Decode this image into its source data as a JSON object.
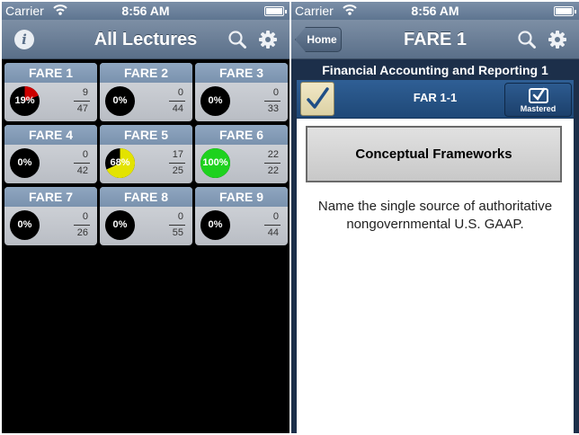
{
  "status": {
    "carrier": "Carrier",
    "time": "8:56 AM"
  },
  "left": {
    "title": "All Lectures",
    "tiles": [
      {
        "name": "FARE 1",
        "percent": "19%",
        "fraction": 0.19,
        "num": "9",
        "den": "47",
        "fill": "#cc0000"
      },
      {
        "name": "FARE 2",
        "percent": "0%",
        "fraction": 0,
        "num": "0",
        "den": "44",
        "fill": "#000000"
      },
      {
        "name": "FARE 3",
        "percent": "0%",
        "fraction": 0,
        "num": "0",
        "den": "33",
        "fill": "#000000"
      },
      {
        "name": "FARE 4",
        "percent": "0%",
        "fraction": 0,
        "num": "0",
        "den": "42",
        "fill": "#000000"
      },
      {
        "name": "FARE 5",
        "percent": "68%",
        "fraction": 0.68,
        "num": "17",
        "den": "25",
        "fill": "#e3e300"
      },
      {
        "name": "FARE 6",
        "percent": "100%",
        "fraction": 1,
        "num": "22",
        "den": "22",
        "fill": "#1ed21e"
      },
      {
        "name": "FARE 7",
        "percent": "0%",
        "fraction": 0,
        "num": "0",
        "den": "26",
        "fill": "#000000"
      },
      {
        "name": "FARE 8",
        "percent": "0%",
        "fraction": 0,
        "num": "0",
        "den": "55",
        "fill": "#000000"
      },
      {
        "name": "FARE 9",
        "percent": "0%",
        "fraction": 0,
        "num": "0",
        "den": "44",
        "fill": "#000000"
      }
    ]
  },
  "right": {
    "home_label": "Home",
    "title": "FARE 1",
    "subject": "Financial Accounting and Reporting 1",
    "card_id": "FAR 1-1",
    "mastered_label": "Mastered",
    "topic": "Conceptual Frameworks",
    "question": "Name the single source of authoritative nongovernmental U.S. GAAP."
  },
  "icons": {
    "info": "info-icon",
    "search": "search-icon",
    "settings": "gear-icon",
    "wifi": "wifi-icon",
    "battery": "battery-icon"
  },
  "colors": {
    "navbar": "#6b7f98",
    "tile_header": "#8fa6c0",
    "card_bar": "#2f5f95",
    "pie_empty": "#000000"
  }
}
